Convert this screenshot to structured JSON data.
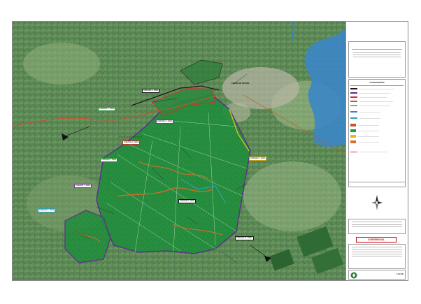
{
  "map": {
    "city_label": "CIDADE DE PAVUNA",
    "callouts": [
      {
        "id": "c1",
        "text": "FAZENDA 1 / ÁREA",
        "color": "#1a1a1a"
      },
      {
        "id": "c2",
        "text": "FAZENDA 2 / ÁREA",
        "color": "#1e8f2a"
      },
      {
        "id": "c3",
        "text": "FAZENDA 3 / ÁREA",
        "color": "#7b3a99"
      },
      {
        "id": "c4",
        "text": "FAZENDA 4 / ÁREA",
        "color": "#d32f2f"
      },
      {
        "id": "c5",
        "text": "FAZENDA 5 / ÁREA",
        "color": "#1e8f2a"
      },
      {
        "id": "c6",
        "text": "FAZENDA 6 / ÁREA",
        "color": "#d4a017"
      },
      {
        "id": "c7",
        "text": "FAZENDA 7 / ÁREA",
        "color": "#7b3a99"
      },
      {
        "id": "c8",
        "text": "FAZENDA 8 / ÁREA",
        "color": "#1a1a1a"
      },
      {
        "id": "c9",
        "text": "FAZENDA 9 / ÁREA",
        "color": "#2aa3b8"
      },
      {
        "id": "c10",
        "text": "FAZENDA 10 / ÁREA",
        "color": "#1a1a1a"
      }
    ]
  },
  "legend": {
    "header_lines": [
      "",
      "",
      ""
    ],
    "section_title": "CONVENÇÕES",
    "confidential_label": "CONFIDENCIAL",
    "scale_label": "1:20.000",
    "footer_text": "",
    "colors": {
      "forest": "#1e9e4a",
      "limit_red": "#d32f2f",
      "limit_purple": "#5b2c8c",
      "limit_yellow": "#d4c21a",
      "limit_cyan": "#2aa3b8",
      "road": "#c8552b",
      "river": "#3b86c6"
    }
  }
}
